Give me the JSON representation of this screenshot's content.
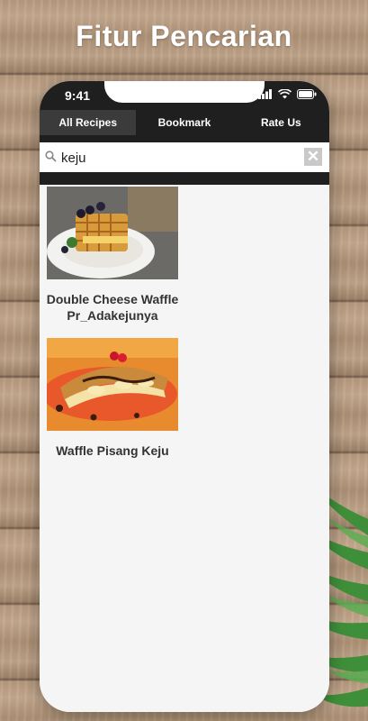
{
  "headline": "Fitur Pencarian",
  "status": {
    "time": "9:41"
  },
  "tabs": [
    {
      "label": "All Recipes",
      "active": true
    },
    {
      "label": "Bookmark",
      "active": false
    },
    {
      "label": "Rate Us",
      "active": false
    }
  ],
  "search": {
    "value": "keju",
    "clear_label": "✕"
  },
  "results": [
    {
      "title_line1": "Double Cheese Waffle",
      "title_line2": "Pr_Adakejunya"
    },
    {
      "title_line1": "Waffle Pisang Keju",
      "title_line2": ""
    }
  ]
}
